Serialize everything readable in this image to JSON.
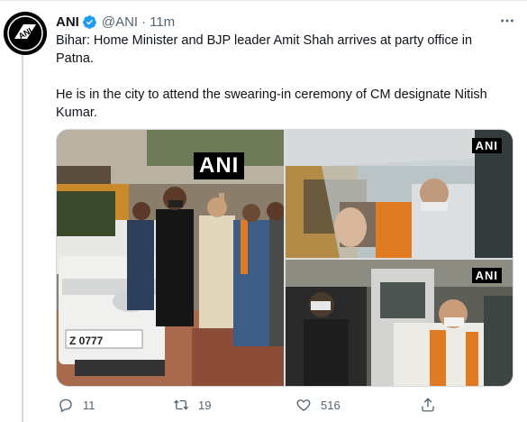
{
  "colors": {
    "verified": "#1d9bf0",
    "secondary_text": "#536471",
    "brand_black": "#000000"
  },
  "tweet": {
    "author_name": "ANI",
    "handle": "@ANI",
    "separator": "·",
    "time": "11m",
    "line1": "Bihar: Home Minister and BJP leader Amit Shah arrives at party office in Patna.",
    "line2": "He is in the city to attend the swearing-in ceremony of CM designate Nitish Kumar."
  },
  "media": {
    "watermark_left": "ANI",
    "watermark_top_right": "ANI",
    "watermark_bottom_right": "ANI",
    "plate_text": "Z 0777"
  },
  "actions": {
    "replies": "11",
    "retweets": "19",
    "likes": "516"
  },
  "icons": [
    "ani-logo-icon",
    "verified-badge-icon",
    "more-options-icon",
    "reply-icon",
    "retweet-icon",
    "like-icon",
    "share-icon"
  ]
}
